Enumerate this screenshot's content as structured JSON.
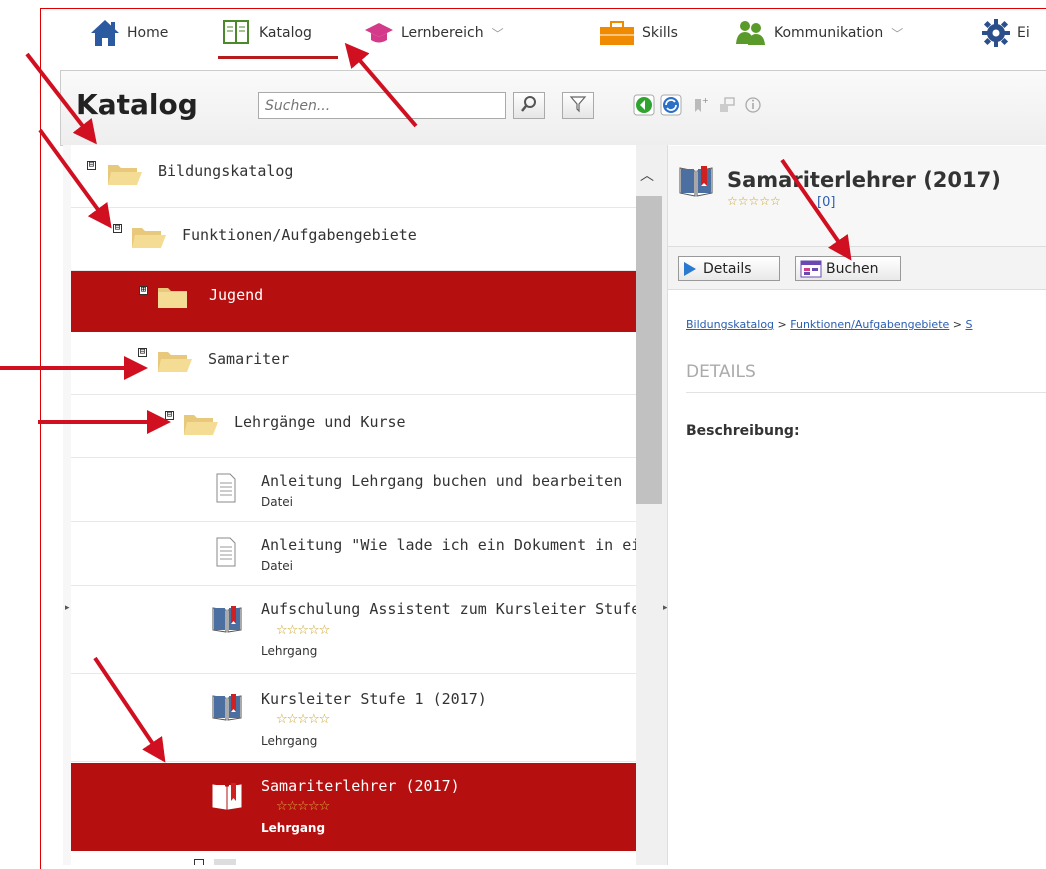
{
  "nav": {
    "items": [
      {
        "label": "Home",
        "icon": "home-icon"
      },
      {
        "label": "Katalog",
        "icon": "book-icon"
      },
      {
        "label": "Lernbereich",
        "icon": "graduation-cap-icon"
      },
      {
        "label": "Skills",
        "icon": "briefcase-icon"
      },
      {
        "label": "Kommunikation",
        "icon": "people-icon"
      },
      {
        "label": "Ei",
        "icon": "gear-icon"
      }
    ],
    "active": "Katalog"
  },
  "toolbar": {
    "title": "Katalog",
    "search_placeholder": "Suchen..."
  },
  "tree": {
    "items": [
      {
        "label": "Bildungskatalog",
        "toggle": "⊟"
      },
      {
        "label": "Funktionen/Aufgabengebiete",
        "toggle": "⊟"
      },
      {
        "label": "Jugend",
        "toggle": "⊞"
      },
      {
        "label": "Samariter",
        "toggle": "⊟"
      },
      {
        "label": "Lehrgänge und Kurse",
        "toggle": "⊟"
      },
      {
        "label": "Anleitung Lehrgang buchen und bearbeiten",
        "sub": "Datei"
      },
      {
        "label": "Anleitung \"Wie lade ich ein Dokument in ei",
        "sub": "Datei"
      },
      {
        "label": "Aufschulung Assistent zum Kursleiter Stufe",
        "sub": "Lehrgang",
        "stars": "☆☆☆☆☆"
      },
      {
        "label": "Kursleiter Stufe 1 (2017)",
        "sub": "Lehrgang",
        "stars": "☆☆☆☆☆"
      },
      {
        "label": "Samariterlehrer (2017)",
        "sub": "Lehrgang",
        "stars": "☆☆☆☆☆"
      }
    ]
  },
  "detail": {
    "title": "Samariterlehrer (2017)",
    "stars": "☆☆☆☆☆",
    "rating_count": "[0]",
    "buttons": {
      "details": "Details",
      "buchen": "Buchen"
    },
    "breadcrumb": {
      "part1": "Bildungskatalog",
      "sep": " > ",
      "part2": "Funktionen/Aufgabengebiete",
      "part3": "S"
    },
    "section": "DETAILS",
    "desc_label": "Beschreibung:"
  },
  "colors": {
    "accent": "#b50f0f",
    "arrow": "#d01020",
    "link": "#2a5db0"
  }
}
